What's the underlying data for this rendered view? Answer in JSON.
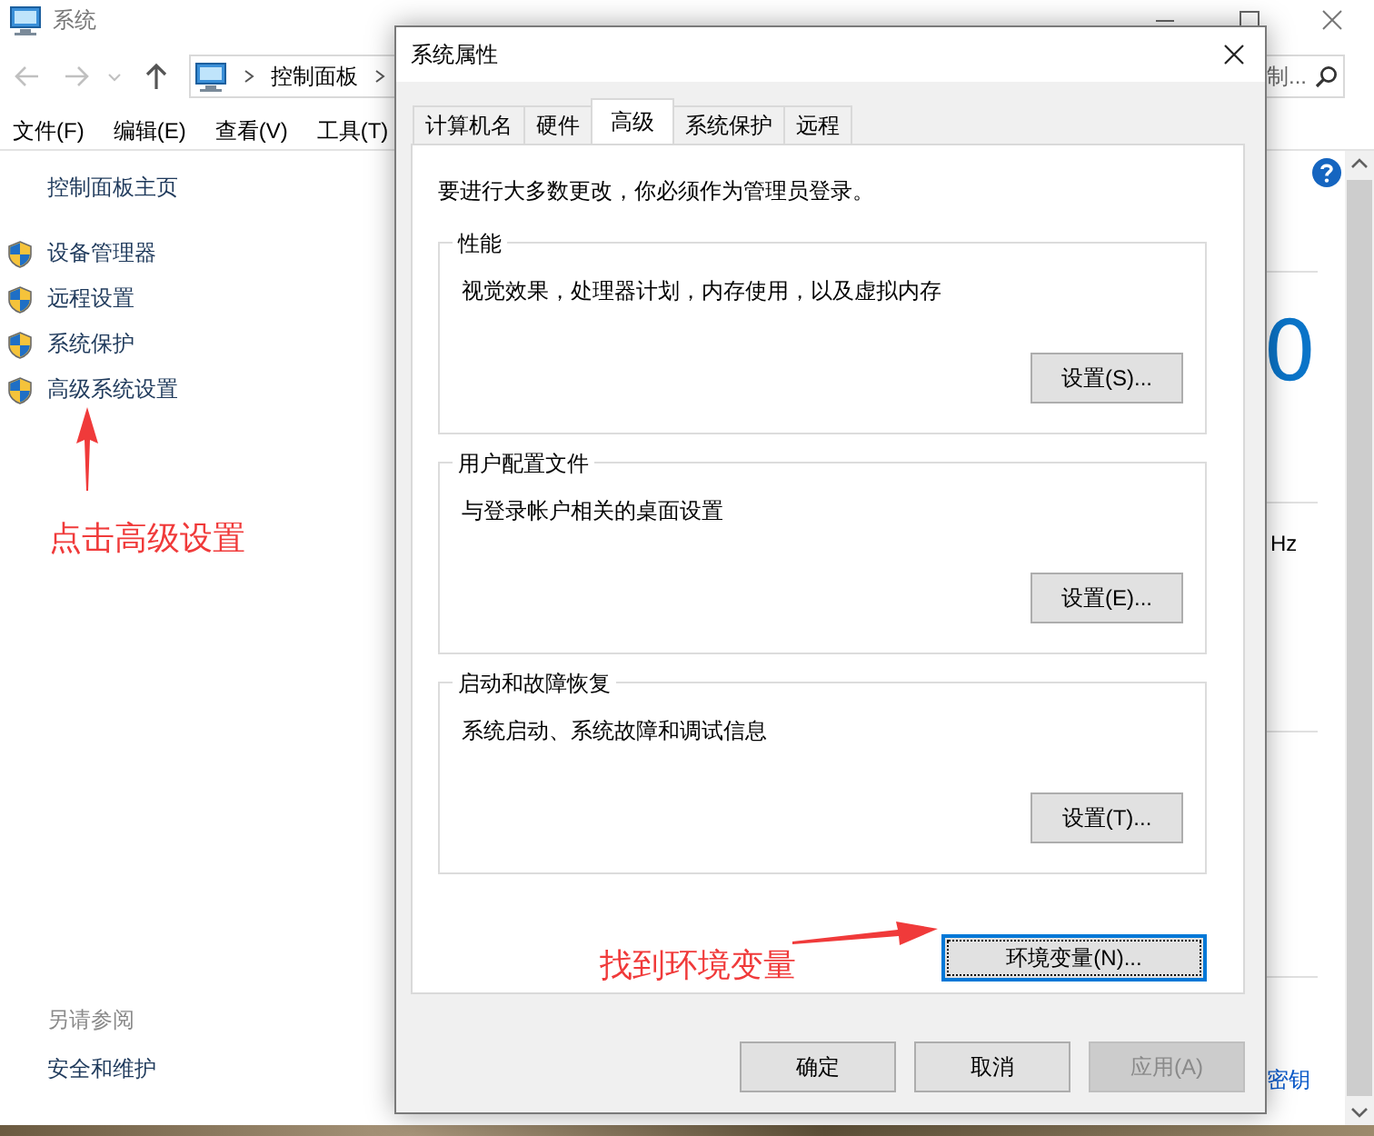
{
  "window": {
    "title": "系统"
  },
  "address": {
    "crumbs": [
      "控制面板"
    ],
    "search_placeholder": "制..."
  },
  "menu": [
    "文件(F)",
    "编辑(E)",
    "查看(V)",
    "工具(T)"
  ],
  "sidebar": {
    "home": "控制面板主页",
    "items": [
      "设备管理器",
      "远程设置",
      "系统保护",
      "高级系统设置"
    ],
    "see_also_title": "另请参阅",
    "see_also": [
      "安全和维护"
    ]
  },
  "main": {
    "big_value": "0",
    "spec": "Hz",
    "link": "密钥"
  },
  "dialog": {
    "title": "系统属性",
    "tabs": [
      {
        "label": "计算机名",
        "selected": false
      },
      {
        "label": "硬件",
        "selected": false
      },
      {
        "label": "高级",
        "selected": true
      },
      {
        "label": "系统保护",
        "selected": false
      },
      {
        "label": "远程",
        "selected": false
      }
    ],
    "intro": "要进行大多数更改，你必须作为管理员登录。",
    "groups": [
      {
        "title": "性能",
        "description": "视觉效果，处理器计划，内存使用，以及虚拟内存",
        "button": "设置(S)..."
      },
      {
        "title": "用户配置文件",
        "description": "与登录帐户相关的桌面设置",
        "button": "设置(E)..."
      },
      {
        "title": "启动和故障恢复",
        "description": "系统启动、系统故障和调试信息",
        "button": "设置(T)..."
      }
    ],
    "env_button": {
      "label": "环境变量(N)...",
      "focused": true
    },
    "buttons": [
      {
        "label": "确定",
        "disabled": false
      },
      {
        "label": "取消",
        "disabled": false
      },
      {
        "label": "应用(A)",
        "disabled": true
      }
    ]
  },
  "annotations": [
    {
      "text": "点击高级设置"
    },
    {
      "text": "找到环境变量"
    }
  ]
}
